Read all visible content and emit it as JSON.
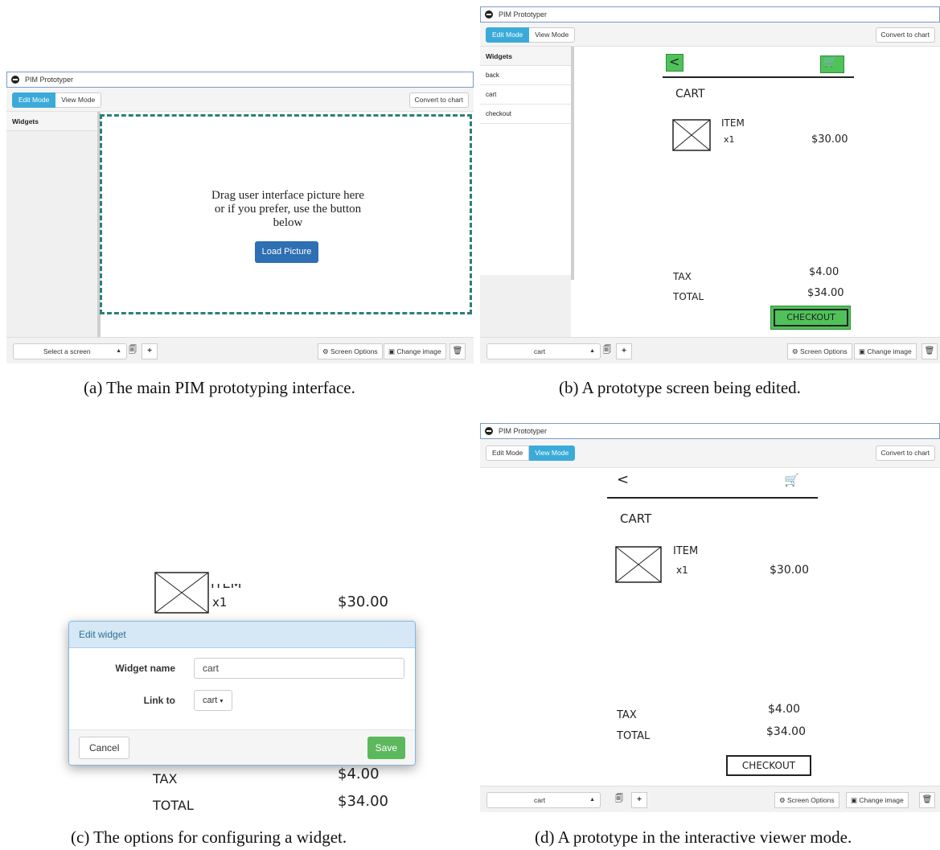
{
  "window_title": "PIM Prototyper",
  "modes": {
    "edit": "Edit Mode",
    "view": "View Mode"
  },
  "convert_label": "Convert to chart",
  "widgets_heading": "Widgets",
  "widget_items": [
    "back",
    "cart",
    "checkout"
  ],
  "select_placeholder": "Select a screen",
  "screen_value": "cart",
  "screen_options_label": "Screen Options",
  "change_image_label": "Change image",
  "drop_text": [
    "Drag user interface picture here",
    "or if you prefer, use the button",
    "below"
  ],
  "load_picture_label": "Load Picture",
  "sketch": {
    "cart_title": "CART",
    "item_label": "ITEM",
    "item_qty": "x1",
    "item_price": "$30.00",
    "tax_label": "TAX",
    "tax_value": "$4.00",
    "total_label": "TOTAL",
    "total_value": "$34.00",
    "checkout_label": "CHECKOUT"
  },
  "modal": {
    "title": "Edit widget",
    "name_label": "Widget name",
    "name_value": "cart",
    "link_label": "Link to",
    "link_value": "cart",
    "cancel_label": "Cancel",
    "save_label": "Save"
  },
  "captions": {
    "a": "(a) The main PIM prototyping interface.",
    "b": "(b) A prototype screen being edited.",
    "c": "(c) The options for configuring a widget.",
    "d": "(d) A prototype in the interactive viewer mode."
  },
  "colors": {
    "accent": "#3aabd9",
    "widget_highlight": "#4fc25a",
    "dashed": "#2b7f7a",
    "save": "#5cb85c"
  }
}
